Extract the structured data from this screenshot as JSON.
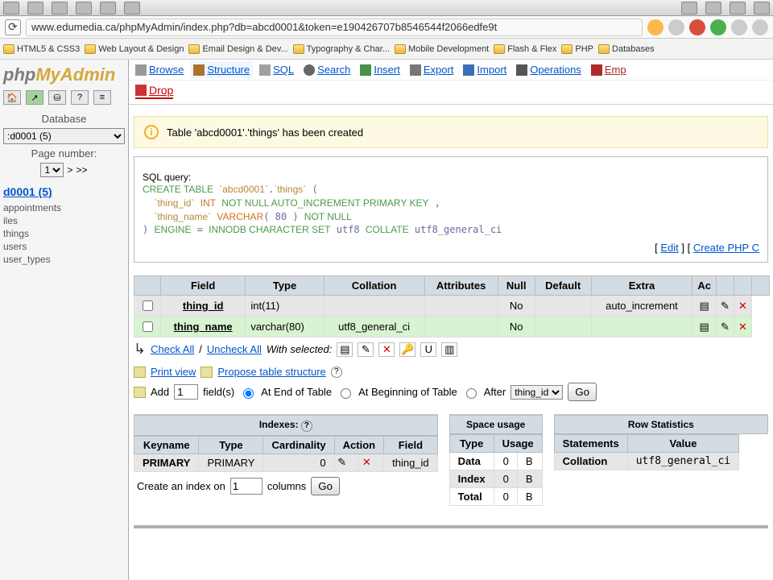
{
  "url": "www.edumedia.ca/phpMyAdmin/index.php?db=abcd0001&token=e190426707b8546544f2066edfe9t",
  "bookmarks": [
    "",
    "HTML5 & CSS3",
    "Web Layout & Design",
    "Email Design & Dev...",
    "Typography & Char...",
    "Mobile Development",
    "Flash & Flex",
    "PHP",
    "Databases"
  ],
  "logo_p1": "php",
  "logo_p2": "MyAdmin",
  "sidebar": {
    "db_label": "Database",
    "db_sel": ":d0001 (5)",
    "page_label": "Page number:",
    "page_sel": "1",
    "nav_prev": ">",
    "nav_next": ">>",
    "db_link": "d0001 (5)",
    "tables": [
      "appointments",
      "iles",
      "things",
      "users",
      "user_types"
    ]
  },
  "tabs": {
    "browse": "Browse",
    "structure": "Structure",
    "sql": "SQL",
    "search": "Search",
    "insert": "Insert",
    "export": "Export",
    "import": "Import",
    "operations": "Operations",
    "empty": "Emp",
    "drop": "Drop"
  },
  "msg": "Table 'abcd0001'.'things' has been created",
  "sql": {
    "legend": "SQL query:",
    "edit": "Edit",
    "createphp": "Create PHP C"
  },
  "field_headers": [
    "Field",
    "Type",
    "Collation",
    "Attributes",
    "Null",
    "Default",
    "Extra",
    "Ac"
  ],
  "fields": [
    {
      "name": "thing_id",
      "type": "int(11)",
      "coll": "",
      "attr": "",
      "null": "No",
      "def": "",
      "extra": "auto_increment"
    },
    {
      "name": "thing_name",
      "type": "varchar(80)",
      "coll": "utf8_general_ci",
      "attr": "",
      "null": "No",
      "def": "",
      "extra": ""
    }
  ],
  "check": {
    "all": "Check All",
    "uncheck": "Uncheck All",
    "with": "With selected:"
  },
  "print": {
    "printview": "Print view",
    "propose": "Propose table structure"
  },
  "add": {
    "add": "Add",
    "fields": "field(s)",
    "atEnd": "At End of Table",
    "atBegin": "At Beginning of Table",
    "after": "After",
    "go": "Go",
    "sel": "thing_id",
    "count": "1"
  },
  "indexes": {
    "title": "Indexes:",
    "headers": [
      "Keyname",
      "Type",
      "Cardinality",
      "Action",
      "Field"
    ],
    "row": {
      "keyname": "PRIMARY",
      "type": "PRIMARY",
      "card": "0",
      "field": "thing_id"
    },
    "create": "Create an index on",
    "cols": "columns",
    "go": "Go",
    "val": "1"
  },
  "space": {
    "title": "Space usage",
    "headers": [
      "Type",
      "Usage"
    ],
    "rows": [
      [
        "Data",
        "0",
        "B"
      ],
      [
        "Index",
        "0",
        "B"
      ],
      [
        "Total",
        "0",
        "B"
      ]
    ]
  },
  "rowstats": {
    "title": "Row Statistics",
    "headers": [
      "Statements",
      "Value"
    ],
    "rows": [
      [
        "Collation",
        "utf8_general_ci"
      ]
    ]
  }
}
